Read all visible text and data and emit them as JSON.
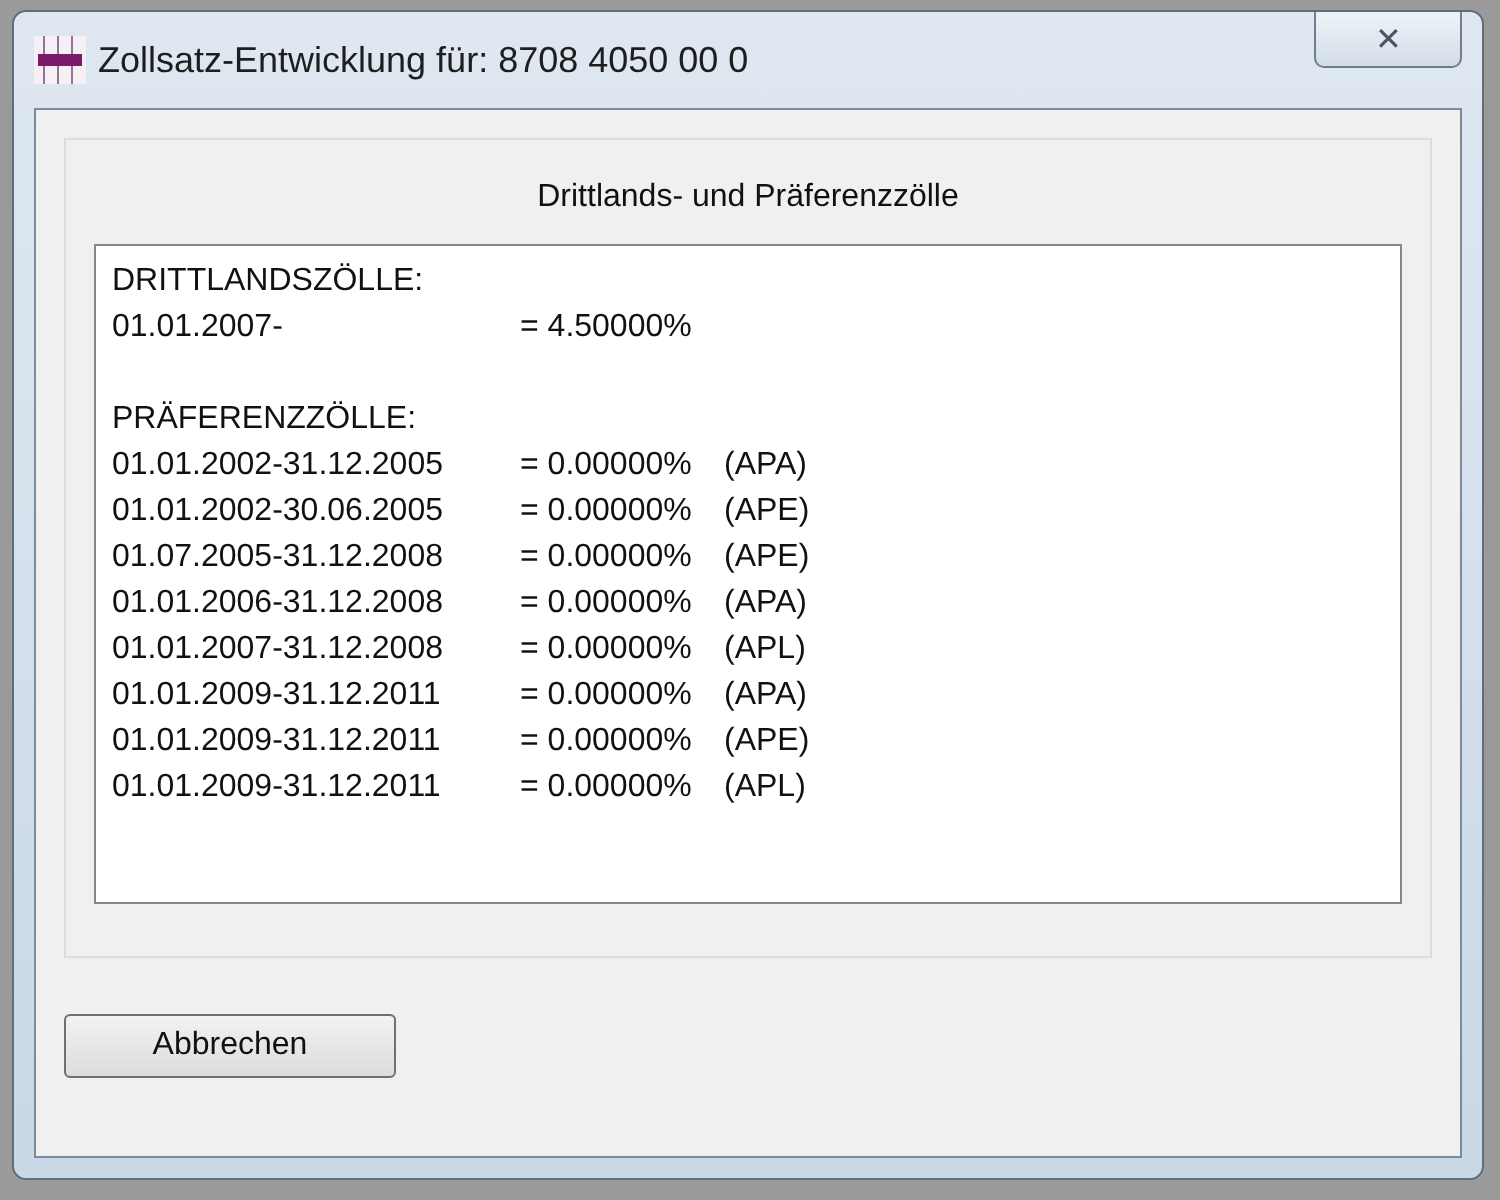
{
  "window": {
    "title": "Zollsatz-Entwicklung für: 8708 4050 00 0",
    "close": "✕"
  },
  "group": {
    "title": "Drittlands- und Präferenzzölle"
  },
  "sections": [
    {
      "heading": "DRITTLANDSZÖLLE:",
      "rows": [
        {
          "period": "01.01.2007-",
          "rate": "= 4.50000%"
        }
      ]
    },
    {
      "heading": "PRÄFERENZZÖLLE:",
      "rows": [
        {
          "period": "01.01.2002-31.12.2005",
          "rate": "= 0.00000%",
          "code": "(APA)"
        },
        {
          "period": "01.01.2002-30.06.2005",
          "rate": "= 0.00000%",
          "code": "(APE)"
        },
        {
          "period": "01.07.2005-31.12.2008",
          "rate": "= 0.00000%",
          "code": "(APE)"
        },
        {
          "period": "01.01.2006-31.12.2008",
          "rate": "= 0.00000%",
          "code": "(APA)"
        },
        {
          "period": "01.01.2007-31.12.2008",
          "rate": "= 0.00000%",
          "code": "(APL)"
        },
        {
          "period": "01.01.2009-31.12.2011",
          "rate": "= 0.00000%",
          "code": "(APA)"
        },
        {
          "period": "01.01.2009-31.12.2011",
          "rate": "= 0.00000%",
          "code": "(APE)"
        },
        {
          "period": "01.01.2009-31.12.2011",
          "rate": "= 0.00000%",
          "code": "(APL)"
        }
      ]
    }
  ],
  "buttons": [
    {
      "label": "Abbrechen"
    }
  ]
}
